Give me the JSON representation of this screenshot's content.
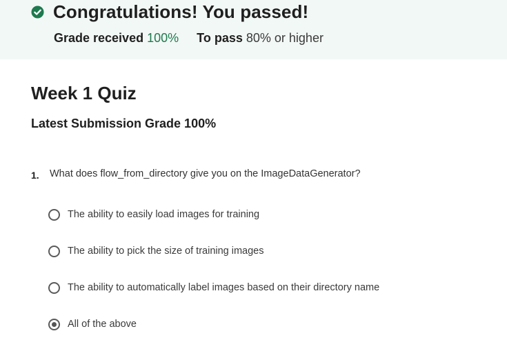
{
  "banner": {
    "title": "Congratulations! You passed!",
    "grade_label": "Grade received",
    "grade_value": "100%",
    "pass_label": "To pass",
    "pass_value": "80% or higher",
    "icon": "check-circle-icon",
    "accent_color": "#1e7a4f",
    "background_color": "#f2f8f5"
  },
  "quiz": {
    "title": "Week 1 Quiz",
    "latest_grade": "Latest Submission Grade 100%"
  },
  "questions": [
    {
      "number": "1.",
      "text": "What does flow_from_directory give you on the ImageDataGenerator?",
      "options": [
        {
          "label": "The ability to easily load images for training",
          "selected": false
        },
        {
          "label": "The ability to pick the size of training images",
          "selected": false
        },
        {
          "label": "The ability to automatically label images based on their directory name",
          "selected": false
        },
        {
          "label": "All of the above",
          "selected": true
        }
      ]
    }
  ]
}
